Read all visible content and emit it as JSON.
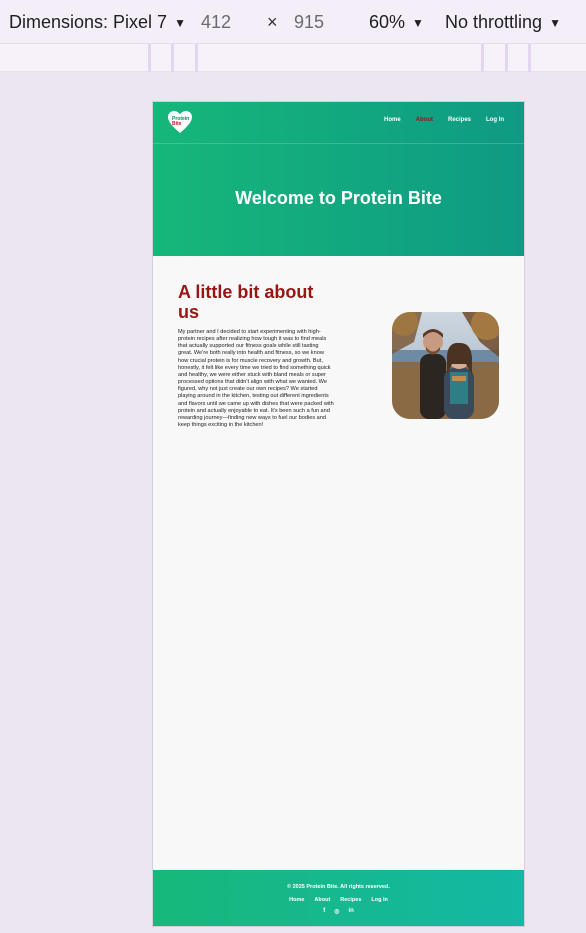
{
  "devtools": {
    "dimensions_label": "Dimensions: Pixel 7",
    "width": "412",
    "times": "×",
    "height": "915",
    "zoom": "60%",
    "throttling": "No throttling"
  },
  "site": {
    "logo": {
      "line1": "Protein",
      "line2": "Bite"
    },
    "nav": {
      "home": "Home",
      "about": "About",
      "recipes": "Recipes",
      "login": "Log In"
    },
    "hero_title": "Welcome to Protein Bite",
    "about": {
      "heading": "A little bit about us",
      "text": "My partner and I decided to start experimenting with high-protein recipes after realizing how tough it was to find meals that actually supported our fitness goals while still tasting great. We're both really into health and fitness, so we know how crucial protein is for muscle recovery and growth. But, honestly, it felt like every time we tried to find something quick and healthy, we were either stuck with bland meals or super processed options that didn't align with what we wanted. We figured, why not just create our own recipes? We started playing around in the kitchen, testing out different ingredients and flavors until we came up with dishes that were packed with protein and actually enjoyable to eat. It's been such a fun and rewarding journey—finding new ways to fuel our bodies and keep things exciting in the kitchen!"
    },
    "footer": {
      "copyright": "© 2025 Protein Bite. All rights reserved.",
      "links": {
        "home": "Home",
        "about": "About",
        "recipes": "Recipes",
        "login": "Log In"
      },
      "social": {
        "facebook": "f",
        "instagram": "◎",
        "linkedin": "in"
      }
    }
  },
  "colors": {
    "header_gradient_start": "#16b77a",
    "header_gradient_end": "#0f9a84",
    "heading_red": "#9b1414",
    "nav_active": "#8a1a1a"
  }
}
